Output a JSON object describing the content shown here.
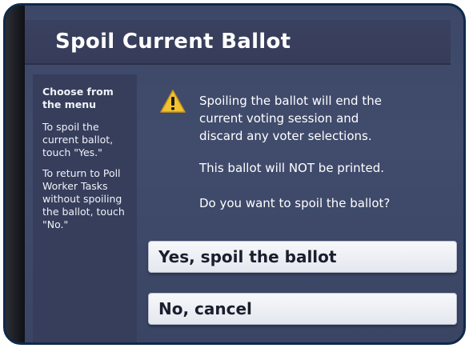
{
  "title": "Spoil Current Ballot",
  "sidebar": {
    "heading": "Choose from the menu",
    "instruction_yes": "To spoil the current ballot, touch \"Yes.\"",
    "instruction_no": "To return to Poll Worker Tasks without spoiling the ballot, touch \"No.\""
  },
  "message": {
    "warning_icon": "warning-triangle-icon",
    "line1": "Spoiling the ballot will end the",
    "line2": "current voting session and",
    "line3": "discard any voter selections.",
    "not_printed": "This ballot will NOT be printed.",
    "question": "Do you want to spoil the ballot?"
  },
  "buttons": {
    "yes_label": "Yes, spoil the ballot",
    "no_label": "No, cancel"
  },
  "colors": {
    "screen_bg": "#414c6d",
    "title_bg": "#363c58",
    "sidebar_bg": "#363e5c",
    "warning_yellow": "#f2c230",
    "button_bg": "#eef0f5"
  }
}
